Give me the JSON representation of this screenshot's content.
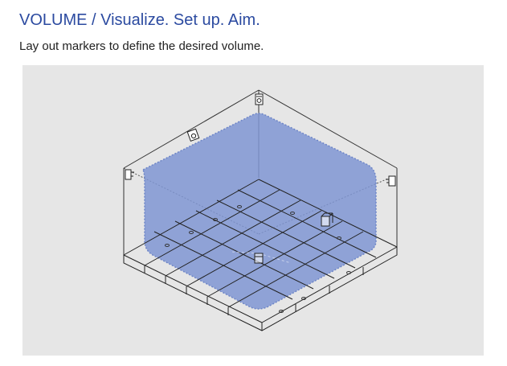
{
  "page": {
    "title": "VOLUME / Visualize. Set up. Aim.",
    "subtitle": "Lay out markers to define the desired volume."
  },
  "illustration": {
    "colors": {
      "panel_background": "#e6e6e6",
      "volume_fill": "#7f95d2",
      "line": "#222222"
    },
    "icons": [
      "camera-icon",
      "marker-cube-icon"
    ]
  }
}
